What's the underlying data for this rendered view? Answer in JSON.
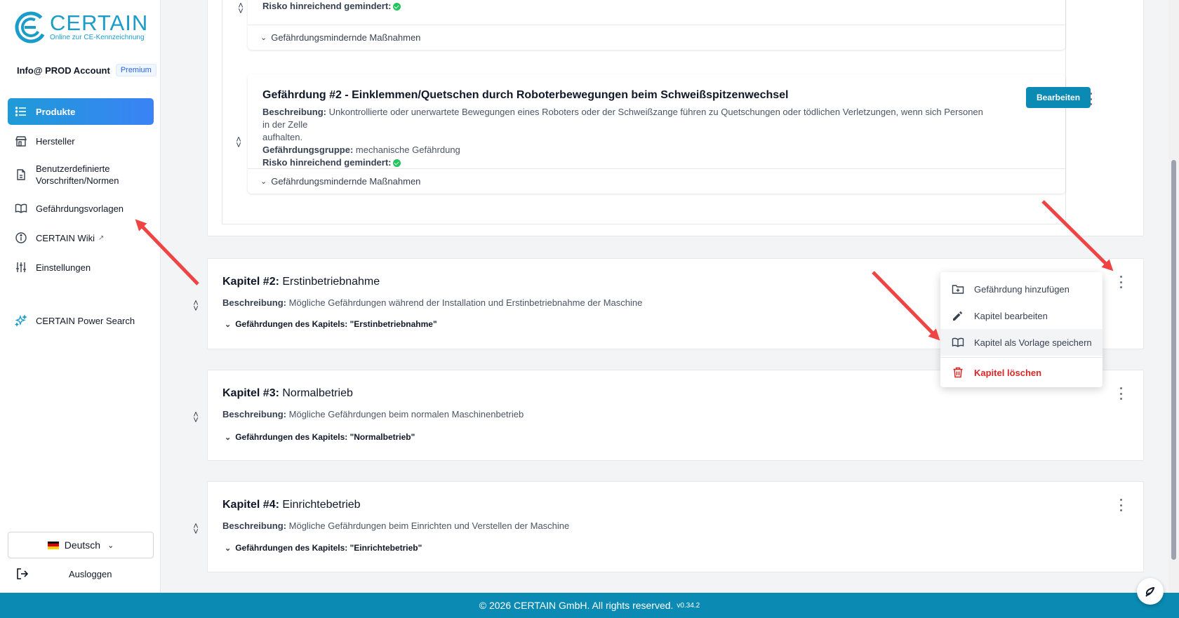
{
  "brand": {
    "name": "CERTAIN",
    "tagline": "Online zur CE-Kennzeichnung",
    "color": "#1b9cc9"
  },
  "account": {
    "name": "Info@ PROD Account",
    "plan": "Premium"
  },
  "sidebar": {
    "items": [
      {
        "label": "Produkte",
        "icon": "list-icon",
        "active": true
      },
      {
        "label": "Hersteller",
        "icon": "store-icon"
      },
      {
        "label": "Benutzerdefinierte Vorschriften/Normen",
        "icon": "document-icon"
      },
      {
        "label": "Gefährdungsvorlagen",
        "icon": "book-icon"
      },
      {
        "label": "CERTAIN Wiki",
        "icon": "info-icon",
        "external": true
      },
      {
        "label": "Einstellungen",
        "icon": "sliders-icon"
      },
      {
        "label": "CERTAIN Power Search",
        "icon": "sparkle-icon"
      }
    ],
    "language": "Deutsch",
    "logout": "Ausloggen"
  },
  "hazards": [
    {
      "risk_label": "Risko hinreichend gemindert:",
      "measures_label": "Gefährdungsmindernde Maßnahmen"
    },
    {
      "title": "Gefährdung #2 - Einklemmen/Quetschen durch Roboterbewegungen beim Schweißspitzenwechsel",
      "desc_label": "Beschreibung:",
      "desc_line1": "Unkontrollierte oder unerwartete Bewegungen eines Roboters oder der Schweißzange führen zu Quetschungen oder tödlichen Verletzungen, wenn sich Personen in der Zelle",
      "desc_line2": "aufhalten.",
      "group_label": "Gefährdungsgruppe:",
      "group": "mechanische Gefährdung",
      "risk_label": "Risko hinreichend gemindert:",
      "edit_label": "Bearbeiten",
      "measures_label": "Gefährdungsmindernde Maßnahmen"
    }
  ],
  "chapters": [
    {
      "number": "Kapitel #2:",
      "name": "Erstinbetriebnahme",
      "desc_label": "Beschreibung:",
      "desc": "Mögliche Gefährdungen während der Installation und Erstinbetriebnahme der Maschine",
      "toggle": "Gefährdungen des Kapitels: \"Erstinbetriebnahme\""
    },
    {
      "number": "Kapitel #3:",
      "name": "Normalbetrieb",
      "desc_label": "Beschreibung:",
      "desc": "Mögliche Gefährdungen beim normalen Maschinenbetrieb",
      "toggle": "Gefährdungen des Kapitels: \"Normalbetrieb\""
    },
    {
      "number": "Kapitel #4:",
      "name": "Einrichtebetrieb",
      "desc_label": "Beschreibung:",
      "desc": "Mögliche Gefährdungen beim Einrichten und Verstellen der Maschine",
      "toggle": "Gefährdungen des Kapitels: \"Einrichtebetrieb\""
    }
  ],
  "menu": {
    "items": [
      {
        "label": "Gefährdung hinzufügen",
        "icon": "folder-plus-icon"
      },
      {
        "label": "Kapitel bearbeiten",
        "icon": "pencil-icon"
      },
      {
        "label": "Kapitel als Vorlage speichern",
        "icon": "book-icon",
        "highlighted": true
      },
      {
        "label": "Kapitel löschen",
        "icon": "trash-icon",
        "danger": true
      }
    ]
  },
  "footer": {
    "text": "© 2026 CERTAIN GmbH. All rights reserved.",
    "version": "v0.34.2"
  },
  "colors": {
    "primary": "#0b8bb3",
    "accent": "#3b82f6",
    "danger": "#dc2626",
    "success": "#22c55e",
    "annotation": "#ef4444"
  }
}
